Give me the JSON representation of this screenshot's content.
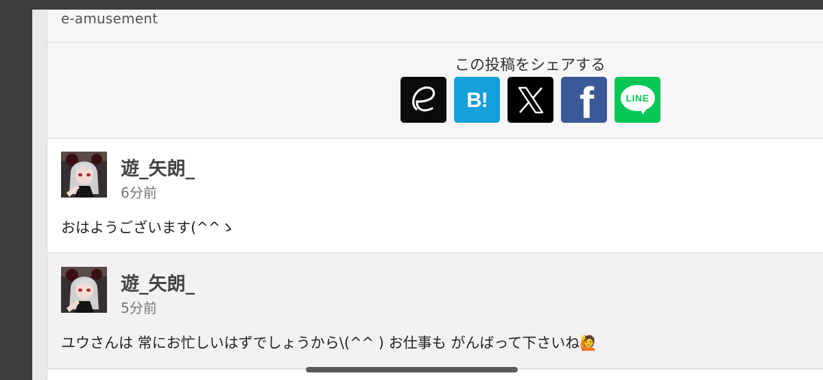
{
  "source": {
    "label": "e-amusement"
  },
  "share": {
    "title": "この投稿をシェアする",
    "buttons": [
      {
        "name": "e-amusement",
        "icon": "e-amusement-icon",
        "color": "#0b0b0b"
      },
      {
        "name": "hatena-bookmark",
        "icon": "hatena-bookmark-icon",
        "glyph": "B!",
        "color": "#16a0db"
      },
      {
        "name": "x",
        "icon": "x-icon",
        "color": "#000000"
      },
      {
        "name": "facebook",
        "icon": "facebook-icon",
        "glyph": "f",
        "color": "#3b5998"
      },
      {
        "name": "line",
        "icon": "line-icon",
        "glyph": "LINE",
        "color": "#06c755"
      }
    ]
  },
  "comments": [
    {
      "user": "遊_矢朗_",
      "time": "6分前",
      "text": "おはようございます(^^ゝ"
    },
    {
      "user": "遊_矢朗_",
      "time": "5分前",
      "text": "ユウさんは 常にお忙しいはずでしょうから\\(^^ ) お仕事も がんばって下さいね🙋"
    }
  ]
}
